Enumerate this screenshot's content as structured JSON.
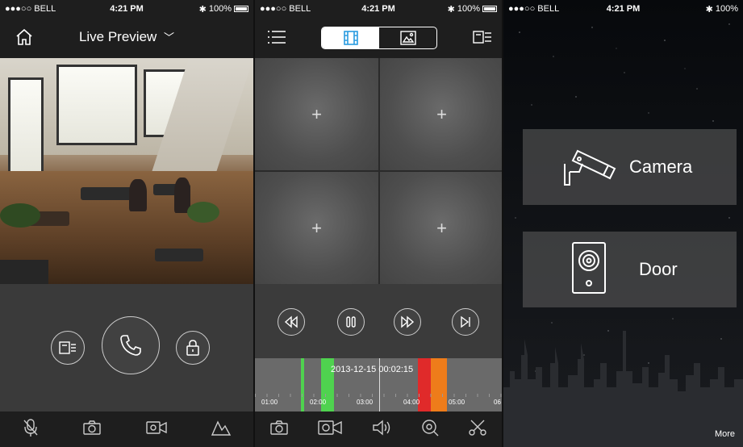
{
  "status": {
    "carrier": "●●●○○ BELL",
    "time": "4:21 PM",
    "battery": "100%",
    "battery_s3": "100%"
  },
  "live_preview": {
    "title": "Live Preview",
    "toolbar": [
      "microphone-icon",
      "camera-icon",
      "video-record-icon",
      "mountain-icon"
    ]
  },
  "playback": {
    "grid_cells": [
      "+",
      "+",
      "+",
      "+"
    ],
    "timestamp": "2013-12-15 00:02:15",
    "time_ticks": [
      "01:00",
      "02:00",
      "03:00",
      "04:00",
      "05:00",
      "06"
    ],
    "segments": [
      {
        "color": "#4fd24f"
      },
      {
        "color": "#4fd24f"
      },
      {
        "color": "#e02a2a"
      },
      {
        "color": "#ee7c1a"
      }
    ]
  },
  "home": {
    "camera_label": "Camera",
    "door_label": "Door",
    "more_label": "More"
  },
  "colors": {
    "nav_bg": "#1e1e1e",
    "panel_bg": "#3a3a3a",
    "green": "#4fd24f",
    "red": "#e02a2a",
    "orange": "#ee7c1a"
  }
}
